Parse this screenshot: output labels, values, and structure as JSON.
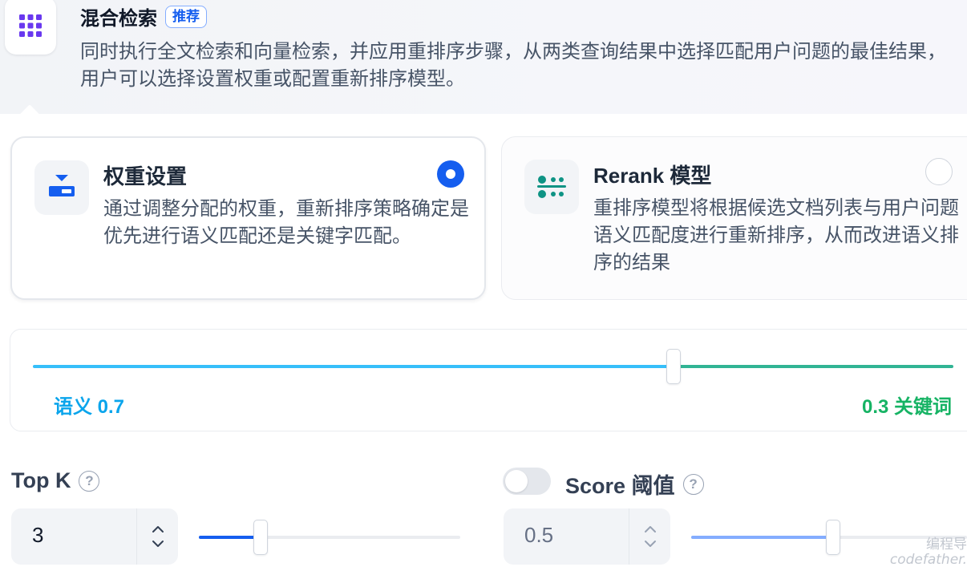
{
  "header": {
    "title": "混合检索",
    "badge": "推荐",
    "description": "同时执行全文检索和向量检索，并应用重排序步骤，从两类查询结果中选择匹配用户问题的最佳结果，用户可以选择设置权重或配置重新排序模型。",
    "icon": "grid-dots-icon"
  },
  "options": [
    {
      "title": "权重设置",
      "description": "通过调整分配的权重，重新排序策略确定是优先进行语义匹配还是关键字匹配。",
      "selected": true,
      "icon": "weight-settings-icon"
    },
    {
      "title": "Rerank 模型",
      "description": "重排序模型将根据候选文档列表与用户问题语义匹配度进行重新排序，从而改进语义排序的结果",
      "selected": false,
      "icon": "rerank-model-icon"
    }
  ],
  "weights": {
    "semantic_label": "语义 0.7",
    "keyword_label": "0.3 关键词",
    "semantic_value": 0.7,
    "keyword_value": 0.3
  },
  "top_k": {
    "label": "Top K",
    "value": "3",
    "slider_fraction": 0.23
  },
  "score_threshold": {
    "label": "Score 阈值",
    "value": "0.5",
    "enabled": false,
    "slider_fraction": 0.5
  },
  "colors": {
    "accent": "#155eef",
    "semantic": "#0ba5ec",
    "keyword": "#16b364"
  },
  "watermark": {
    "line1": "编程导",
    "line2": "codefather."
  }
}
